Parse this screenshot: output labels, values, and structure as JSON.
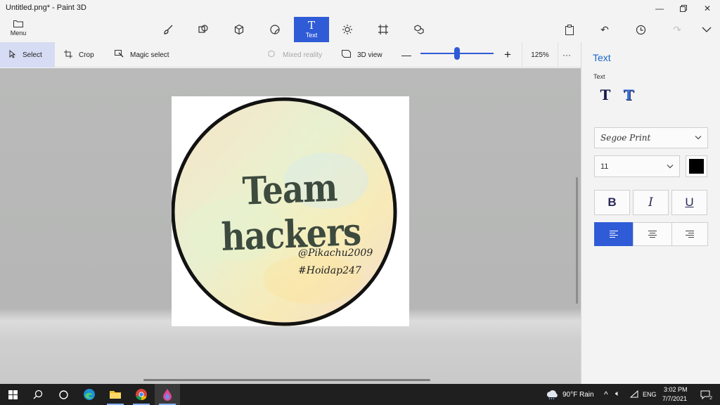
{
  "window": {
    "title": "Untitled.png* - Paint 3D",
    "minimize_icon": "minimize-icon",
    "maximize_icon": "restore-icon",
    "close_icon": "close-icon"
  },
  "ribbon": {
    "menu_label": "Menu",
    "tools": [
      {
        "name": "brushes",
        "icon": "brush-icon"
      },
      {
        "name": "2d-shapes",
        "icon": "2d-shapes-icon"
      },
      {
        "name": "3d-shapes",
        "icon": "3d-shapes-icon"
      },
      {
        "name": "stickers",
        "icon": "stickers-icon"
      },
      {
        "name": "text",
        "icon": "text-icon",
        "label": "Text",
        "active": true
      },
      {
        "name": "effects",
        "icon": "effects-icon"
      },
      {
        "name": "canvas",
        "icon": "canvas-icon"
      },
      {
        "name": "3d-library",
        "icon": "3d-library-icon"
      }
    ],
    "right_tools": [
      "paste-icon",
      "undo-icon",
      "history-icon",
      "redo-icon",
      "expand-icon"
    ]
  },
  "toolbar": {
    "select": "Select",
    "crop": "Crop",
    "magic_select": "Magic select",
    "mixed_reality": "Mixed reality",
    "view_3d": "3D view",
    "zoom_percent": "125%",
    "zoom_level": 0.5,
    "more": "···"
  },
  "image": {
    "title": "Team hackers",
    "line1": "@Pikachu2009",
    "line2": "#Hoidap247"
  },
  "panel": {
    "title": "Text",
    "subtitle": "Text",
    "font_family": "Segoe Print",
    "font_size": "11",
    "text_color": "#000000",
    "bold": "B",
    "italic": "I",
    "underline": "U",
    "alignment": "left"
  },
  "taskbar": {
    "weather": "90°F Rain",
    "language": "ENG",
    "time": "3:02 PM",
    "date": "7/7/2021",
    "notifications": "2"
  },
  "colors": {
    "accent": "#2f5bd6",
    "panel_title": "#1a65c9"
  }
}
